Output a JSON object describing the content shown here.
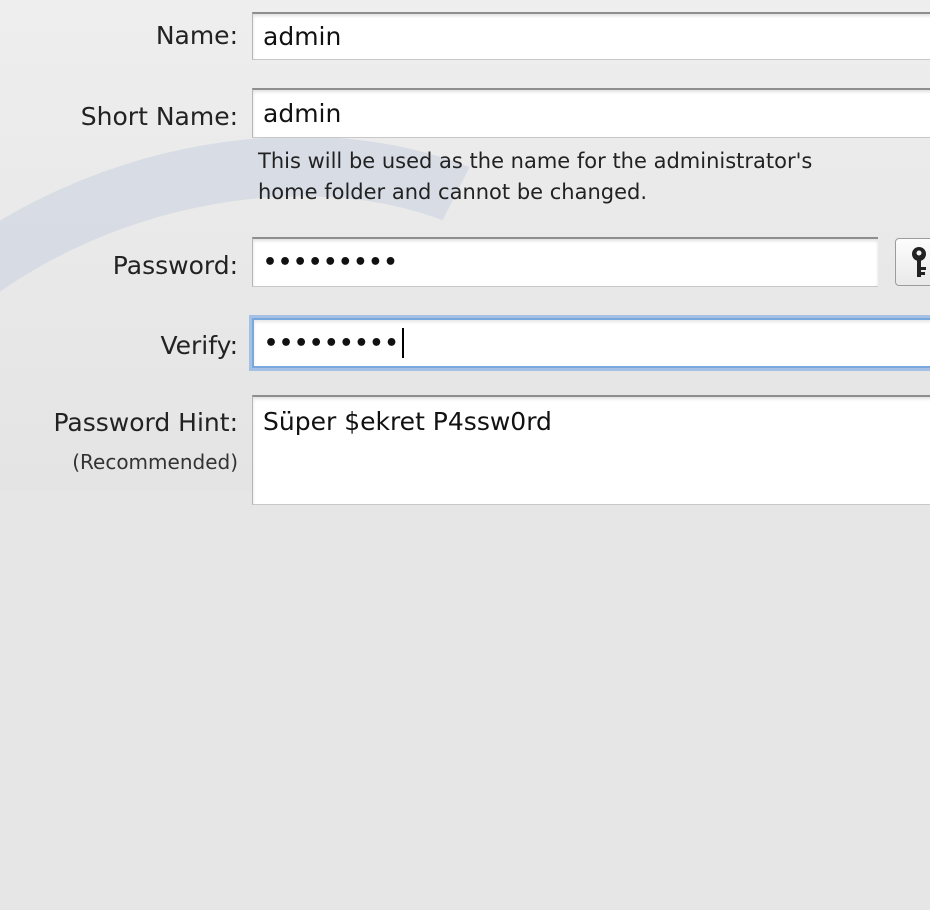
{
  "form": {
    "name": {
      "label": "Name:",
      "value": "admin"
    },
    "short_name": {
      "label": "Short Name:",
      "value": "admin",
      "help_line1": "This will be used as the name for the administrator's",
      "help_line2": "home folder and cannot be changed."
    },
    "password": {
      "label": "Password:",
      "masked_value": "•••••••••"
    },
    "verify": {
      "label": "Verify:",
      "masked_value": "•••••••••"
    },
    "hint": {
      "label": "Password Hint:",
      "sublabel": "(Recommended)",
      "value": "Süper $ekret P4ssw0rd"
    }
  },
  "icons": {
    "password_assistant": "key-icon"
  },
  "colors": {
    "background": "#e6e6e6",
    "focus_ring": "#7aa7dc"
  }
}
